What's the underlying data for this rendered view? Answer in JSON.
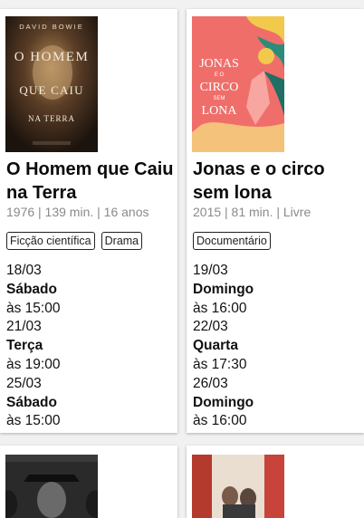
{
  "movies": [
    {
      "poster": {
        "top_text": "DAVID BOWIE",
        "title_lines": [
          "O HOMEM",
          "QUE CAIU",
          "NA TERRA"
        ]
      },
      "title": "O Homem que Caiu na Terra",
      "meta": "1976 | 139 min. | 16 anos",
      "genres": [
        "Ficção científica",
        "Drama"
      ],
      "sessions": [
        {
          "date": "18/03",
          "day": "Sábado",
          "time": "às 15:00"
        },
        {
          "date": "21/03",
          "day": "Terça",
          "time": "às 19:00"
        },
        {
          "date": "25/03",
          "day": "Sábado",
          "time": "às 15:00"
        }
      ]
    },
    {
      "poster": {
        "title_lines": [
          "JONAS",
          "E O",
          "CIRCO",
          "SEM",
          "LONA"
        ]
      },
      "title": "Jonas e o circo sem lona",
      "meta": "2015 | 81 min. | Livre",
      "genres": [
        "Documentário"
      ],
      "sessions": [
        {
          "date": "19/03",
          "day": "Domingo",
          "time": "às 16:00"
        },
        {
          "date": "22/03",
          "day": "Quarta",
          "time": "às 17:30"
        },
        {
          "date": "26/03",
          "day": "Domingo",
          "time": "às 16:00"
        }
      ]
    }
  ],
  "colors": {
    "page_bg": "#f1f1f1",
    "card_bg": "#ffffff",
    "meta_text": "#8a8a8a",
    "poster1_bg": "#3a2a1e",
    "poster2_bg": "#ef6e6a"
  }
}
